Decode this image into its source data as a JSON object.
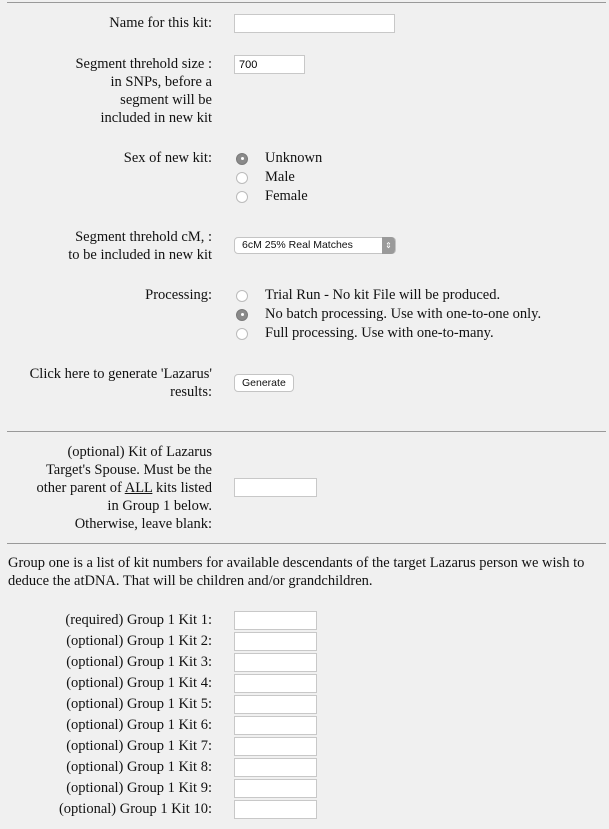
{
  "form": {
    "kit_name": {
      "label": "Name for this kit:",
      "value": ""
    },
    "segment_snps": {
      "label_lines": [
        "Segment threhold size :",
        "in SNPs, before a",
        "segment will be",
        "included in new kit"
      ],
      "value": "700"
    },
    "sex": {
      "label": "Sex of new kit:",
      "options": [
        {
          "label": "Unknown",
          "selected": true
        },
        {
          "label": "Male",
          "selected": false
        },
        {
          "label": "Female",
          "selected": false
        }
      ]
    },
    "segment_cm": {
      "label_lines": [
        "Segment threhold cM, :",
        "to be included in new kit"
      ],
      "selected": "6cM 25% Real Matches"
    },
    "processing": {
      "label": "Processing:",
      "options": [
        {
          "label": "Trial Run - No kit File will be produced.",
          "selected": false
        },
        {
          "label": "No batch processing. Use with one-to-one only.",
          "selected": true
        },
        {
          "label": "Full processing. Use with one-to-many.",
          "selected": false
        }
      ]
    },
    "generate": {
      "label_lines": [
        "Click here to generate 'Lazarus'",
        "results:"
      ],
      "button": "Generate"
    },
    "spouse": {
      "label_line1": "(optional) Kit of Lazarus",
      "label_line2": "Target's Spouse. Must be the",
      "label_line3_pre": "other parent of ",
      "label_line3_u": "ALL",
      "label_line3_post": " kits listed",
      "label_line4": "in Group 1 below.",
      "label_line5": "Otherwise, leave blank:",
      "value": ""
    },
    "group1_description": "Group one is a list of kit numbers for available descendants of the target Lazarus person we wish to deduce the atDNA. That will be children and/or grandchildren.",
    "group1_kits": [
      {
        "label": "(required) Group 1 Kit 1:",
        "value": ""
      },
      {
        "label": "(optional) Group 1 Kit 2:",
        "value": ""
      },
      {
        "label": "(optional) Group 1 Kit 3:",
        "value": ""
      },
      {
        "label": "(optional) Group 1 Kit 4:",
        "value": ""
      },
      {
        "label": "(optional) Group 1 Kit 5:",
        "value": ""
      },
      {
        "label": "(optional) Group 1 Kit 6:",
        "value": ""
      },
      {
        "label": "(optional) Group 1 Kit 7:",
        "value": ""
      },
      {
        "label": "(optional) Group 1 Kit 8:",
        "value": ""
      },
      {
        "label": "(optional) Group 1 Kit 9:",
        "value": ""
      },
      {
        "label": "(optional) Group 1 Kit 10:",
        "value": ""
      }
    ]
  }
}
